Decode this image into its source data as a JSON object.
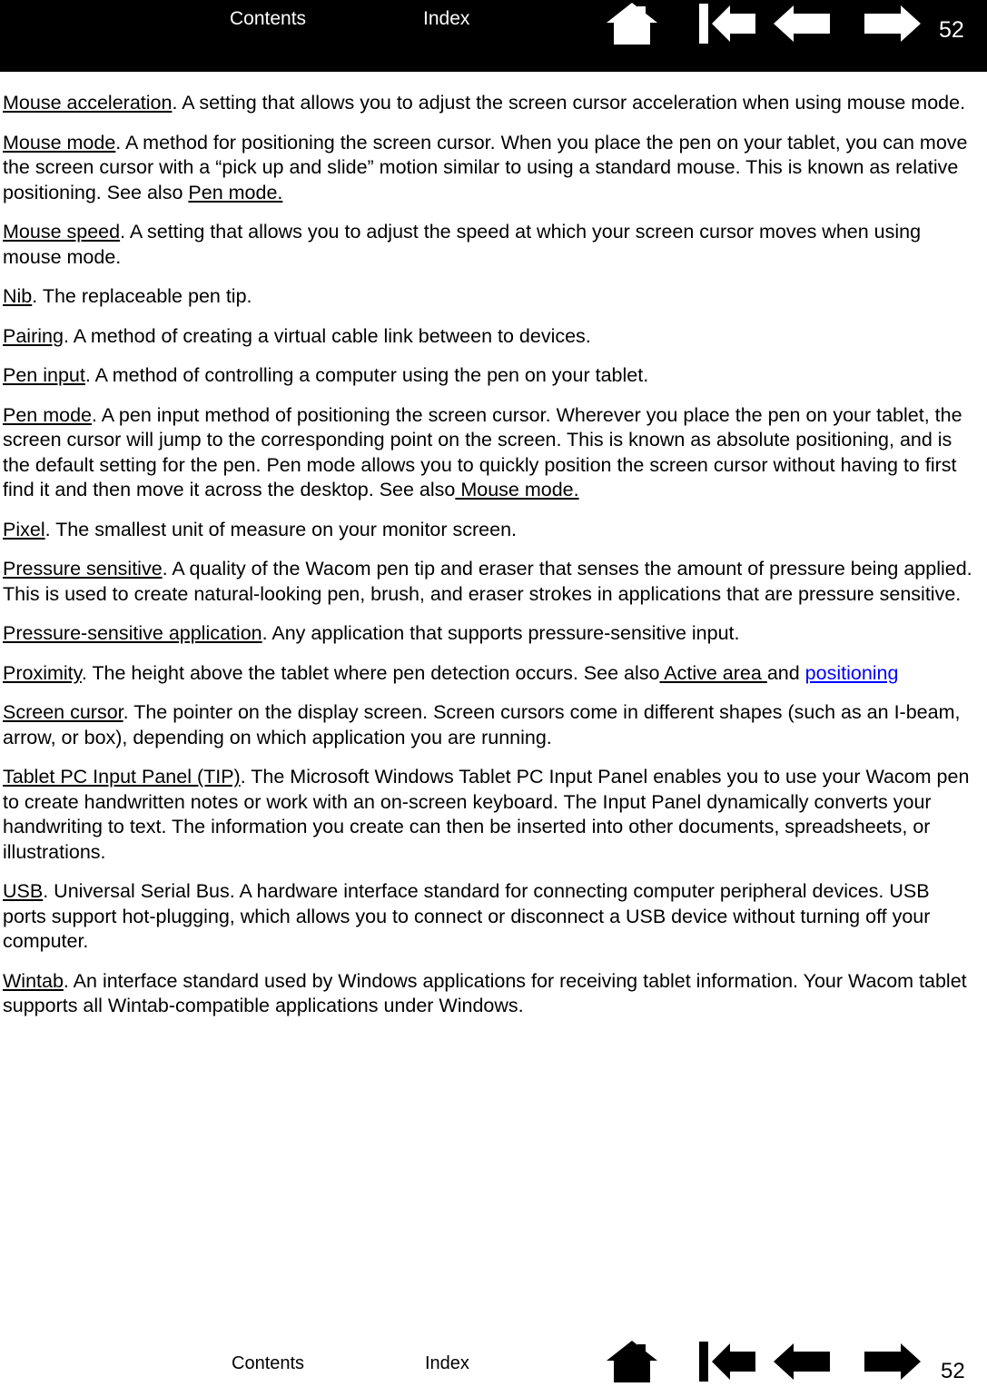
{
  "header": {
    "contents_label": "Contents",
    "index_label": "Index",
    "page_number": "52",
    "icons": [
      {
        "name": "home-icon",
        "title": "Home"
      },
      {
        "name": "go-to-start-icon",
        "title": "Go to start"
      },
      {
        "name": "previous-page-icon",
        "title": "Previous page"
      },
      {
        "name": "next-page-icon",
        "title": "Next page"
      }
    ],
    "background_color": "#000000",
    "foreground_color": "#ffffff"
  },
  "footer": {
    "contents_label": "Contents",
    "index_label": "Index",
    "page_number": "52",
    "icons": [
      {
        "name": "home-icon",
        "title": "Home"
      },
      {
        "name": "go-to-start-icon",
        "title": "Go to start"
      },
      {
        "name": "previous-page-icon",
        "title": "Previous page"
      },
      {
        "name": "next-page-icon",
        "title": "Next page"
      }
    ],
    "background_color": "#ffffff",
    "foreground_color": "#000000"
  },
  "link_color": "#0000ff",
  "glossary": [
    {
      "id": "mouse-acceleration",
      "term": "Mouse acceleration",
      "body": ".  A setting that allows you to adjust the screen cursor acceleration when using mouse mode."
    },
    {
      "id": "mouse-mode",
      "term": "Mouse mode",
      "body_before": ".  A method for positioning the screen cursor. When you place the pen on your tablet, you can move the screen cursor with a “pick up and slide” motion similar to using a standard mouse. This is known as relative positioning. See also ",
      "xref": "Pen mode.",
      "body_after": ""
    },
    {
      "id": "mouse-speed",
      "term": "Mouse speed",
      "body": ".  A setting that allows you to adjust the speed at which your screen cursor moves when using mouse mode."
    },
    {
      "id": "nib",
      "term": "Nib",
      "body": ".  The replaceable pen tip."
    },
    {
      "id": "pairing",
      "term": "Pairing",
      "body": ".  A method of creating a virtual cable link between to devices."
    },
    {
      "id": "pen-input",
      "term": "Pen input",
      "body": ".  A method of controlling a computer using the pen on your tablet."
    },
    {
      "id": "pen-mode",
      "term": "Pen mode",
      "body_before": ".  A pen input method of positioning the screen cursor. Wherever you place the pen on your tablet, the screen cursor will jump to the corresponding point on the screen. This is known as absolute positioning, and is the default setting for the pen. Pen mode allows you to quickly position the screen cursor without having to first find it and then move it across the desktop. See also",
      "xref": " Mouse mode.",
      "body_after": ""
    },
    {
      "id": "pixel",
      "term": "Pixel",
      "body": ".  The smallest unit of measure on your monitor screen."
    },
    {
      "id": "pressure-sensitive",
      "term": "Pressure sensitive",
      "body": ".  A quality of the Wacom pen tip and eraser that senses the amount of pressure being applied. This is used to create natural-looking pen, brush, and eraser strokes in applications that are pressure sensitive."
    },
    {
      "id": "pressure-sensitive-application",
      "term": "Pressure-sensitive application",
      "body": ".  Any application that supports pressure-sensitive input."
    },
    {
      "id": "proximity",
      "term": "Proximity",
      "body_before": ".  The height above the tablet where pen detection occurs. See also",
      "xref": " Active area ",
      "body_mid": "and ",
      "xref_blue": "positioning",
      "body_after": ""
    },
    {
      "id": "screen-cursor",
      "term": "Screen cursor",
      "body": ".  The pointer on the display screen. Screen cursors come in different shapes (such as an I-beam, arrow, or box), depending on which application you are running."
    },
    {
      "id": "tablet-pc-input-panel",
      "term": "Tablet PC Input Panel (TIP)",
      "body": ".  The Microsoft Windows Tablet PC Input Panel enables you to use your Wacom pen to create handwritten notes or work with an on-screen keyboard. The Input Panel dynamically converts your handwriting to text. The information you create can then be inserted into other documents, spreadsheets, or illustrations."
    },
    {
      "id": "usb",
      "term": "USB",
      "body": ".  Universal Serial Bus. A hardware interface standard for connecting computer peripheral devices. USB ports support hot-plugging, which allows you to connect or disconnect a USB device without turning off your computer."
    },
    {
      "id": "wintab",
      "term": "Wintab",
      "body": ".  An interface standard used by Windows applications for receiving tablet information. Your Wacom tablet supports all Wintab-compatible applications under Windows."
    }
  ]
}
